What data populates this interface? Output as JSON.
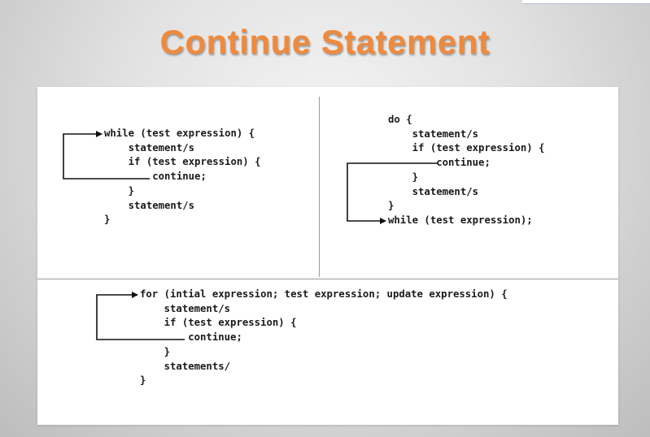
{
  "slide": {
    "title": "Continue Statement"
  },
  "diagrams": {
    "while_loop": {
      "lines": [
        "while (test expression) {",
        "    statement/s",
        "    if (test expression) {",
        "        continue;",
        "    }",
        "    statement/s",
        "}"
      ]
    },
    "do_while_loop": {
      "lines": [
        "do {",
        "    statement/s",
        "    if (test expression) {",
        "        continue;",
        "    }",
        "    statement/s",
        "}",
        "while (test expression);"
      ]
    },
    "for_loop": {
      "lines": [
        "for (intial expression; test expression; update expression) {",
        "    statement/s",
        "    if (test expression) {",
        "        continue;",
        "    }",
        "    statements/",
        "}"
      ]
    }
  },
  "colors": {
    "title": "#ef8a3c",
    "code": "#1a1a1a",
    "arrow": "#111111"
  }
}
